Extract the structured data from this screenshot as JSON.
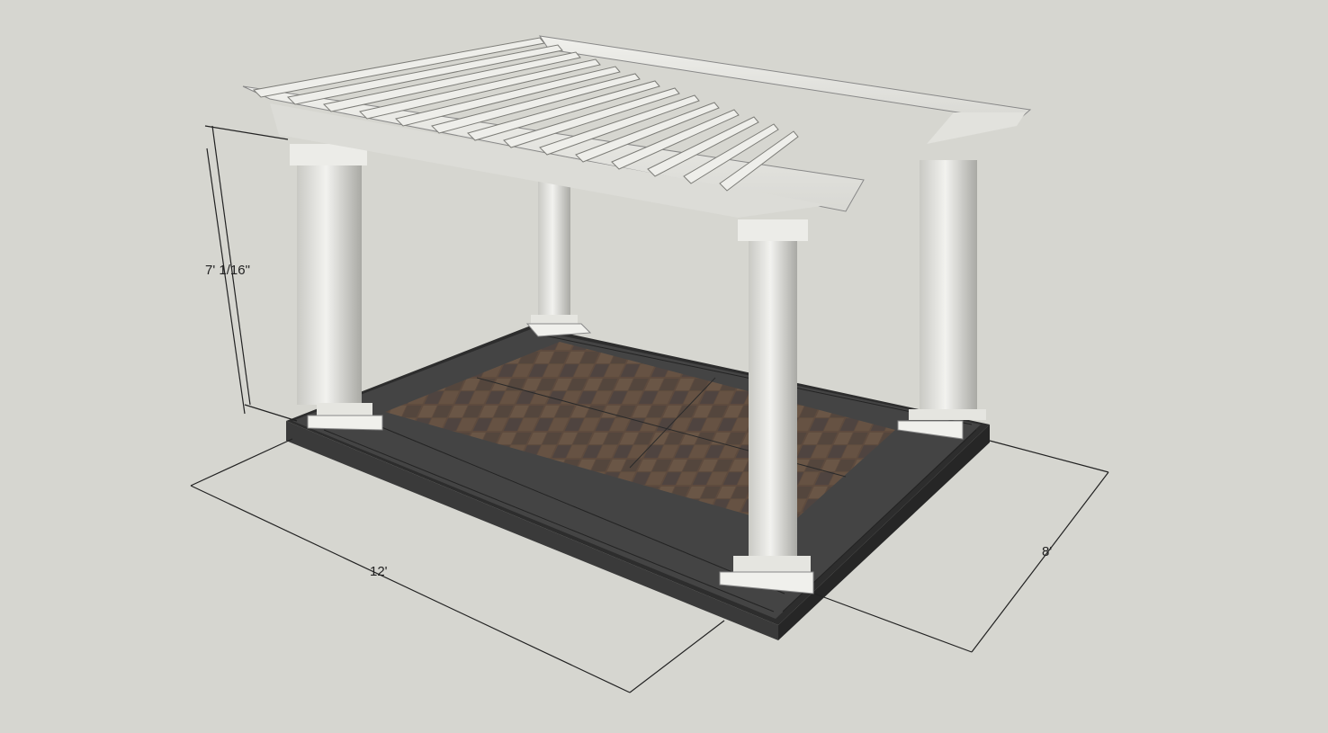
{
  "background_color": "#d6d6d0",
  "dimensions": {
    "height": "7' 1/16\"",
    "length": "12'",
    "width": "8'"
  },
  "colors": {
    "column": "#e8e8e4",
    "column_shade": "#b8b8b2",
    "beam": "#e9e9e5",
    "border_paver": "#3c3c3c",
    "inner_paver": "#5e4b3e",
    "dimension_line": "#222222"
  }
}
